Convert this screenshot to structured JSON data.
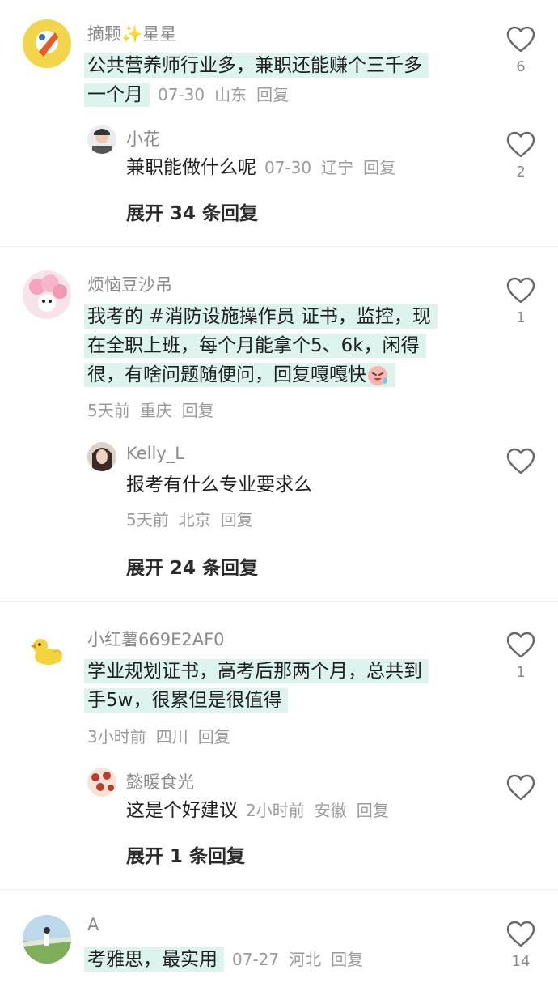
{
  "comments": [
    {
      "username": "摘颗✨星星",
      "lines": [
        "公共营养师行业多，兼职还能赚个三千多",
        "一个月"
      ],
      "date": "07-30",
      "location": "山东",
      "reply_label": "回复",
      "likes": "6",
      "reply": {
        "username": "小花",
        "text": "兼职能做什么呢",
        "date": "07-30",
        "location": "辽宁",
        "reply_label": "回复",
        "likes": "2"
      },
      "expand_label": "展开 34 条回复"
    },
    {
      "username": "烦恼豆沙吊",
      "lines": [
        "我考的 #消防设施操作员 证书，监控，现",
        "在全职上班，每个月能拿个5、6k，闲得",
        "很，有啥问题随便问，回复嘎嘎快"
      ],
      "date": "5天前",
      "location": "重庆",
      "reply_label": "回复",
      "likes": "1",
      "reply": {
        "username": "Kelly_L",
        "text": "报考有什么专业要求么",
        "date": "5天前",
        "location": "北京",
        "reply_label": "回复",
        "likes": ""
      },
      "expand_label": "展开 24 条回复"
    },
    {
      "username": "小红薯669E2AF0",
      "lines": [
        "学业规划证书，高考后那两个月，总共到",
        "手5w，很累但是很值得"
      ],
      "date": "3小时前",
      "location": "四川",
      "reply_label": "回复",
      "likes": "1",
      "reply": {
        "username": "懿暖食光",
        "text": "这是个好建议",
        "date": "2小时前",
        "location": "安徽",
        "reply_label": "回复",
        "likes": ""
      },
      "expand_label": "展开 1 条回复"
    },
    {
      "username": "A",
      "lines": [
        "考雅思，最实用"
      ],
      "date": "07-27",
      "location": "河北",
      "reply_label": "回复",
      "likes": "14"
    }
  ],
  "colors": {
    "highlight": "#dcf3ee",
    "meta": "#9a9a9a",
    "username": "#8a8a8a"
  },
  "icons": {
    "like": "heart-outline-icon"
  }
}
